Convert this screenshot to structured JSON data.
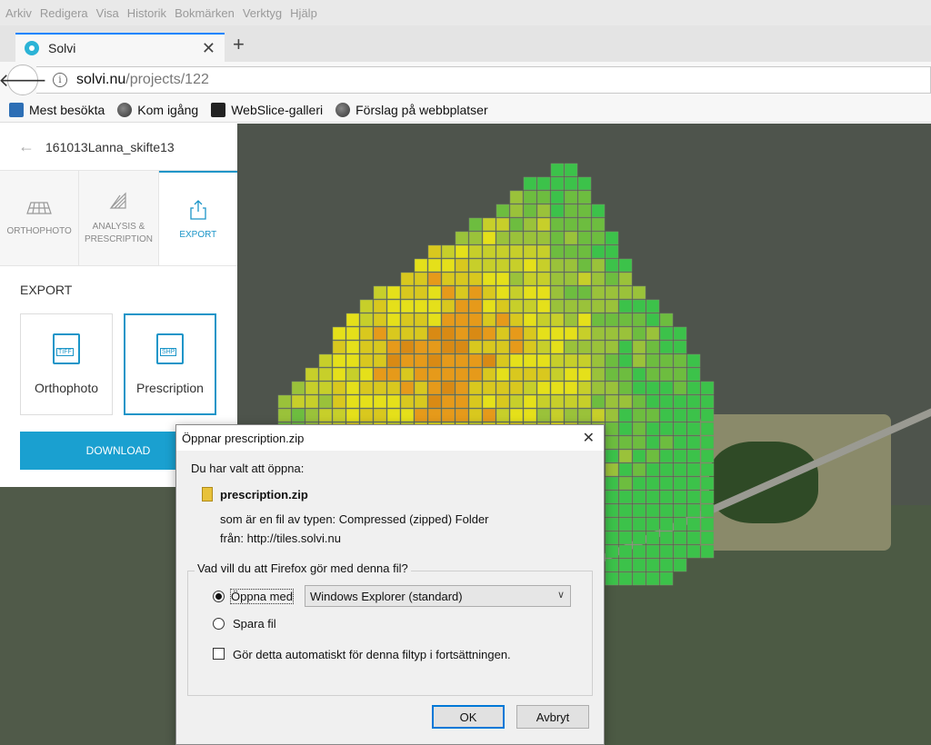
{
  "menubar": {
    "items": [
      "Arkiv",
      "Redigera",
      "Visa",
      "Historik",
      "Bokmärken",
      "Verktyg",
      "Hjälp"
    ]
  },
  "tab": {
    "title": "Solvi",
    "close": "✕",
    "new_tab": "+"
  },
  "address": {
    "host": "solvi.nu",
    "path": "/projects/122"
  },
  "bookmarks": [
    "Mest besökta",
    "Kom igång",
    "WebSlice-galleri",
    "Förslag på webbplatser"
  ],
  "sidebar": {
    "project_name": "161013Lanna_skifte13",
    "tabs": [
      {
        "label": "ORTHOPHOTO"
      },
      {
        "label": "ANALYSIS & PRESCRIPTION"
      },
      {
        "label": "EXPORT"
      }
    ],
    "export_title": "EXPORT",
    "cards": [
      {
        "label": "Orthophoto",
        "badge": "TIFF"
      },
      {
        "label": "Prescription",
        "badge": "SHP"
      }
    ],
    "download_label": "DOWNLOAD"
  },
  "dialog": {
    "title": "Öppnar prescription.zip",
    "close": "✕",
    "intro": "Du har valt att öppna:",
    "filename": "prescription.zip",
    "type_line": "som är en fil av typen:  Compressed (zipped) Folder",
    "from_line": "från:  http://tiles.solvi.nu",
    "question": "Vad vill du att Firefox gör med denna fil?",
    "open_with_label": "Öppna med",
    "open_with_value": "Windows Explorer (standard)",
    "save_label": "Spara fil",
    "auto_label": "Gör detta automatiskt för denna filtyp i fortsättningen.",
    "ok_label": "OK",
    "cancel_label": "Avbryt"
  }
}
